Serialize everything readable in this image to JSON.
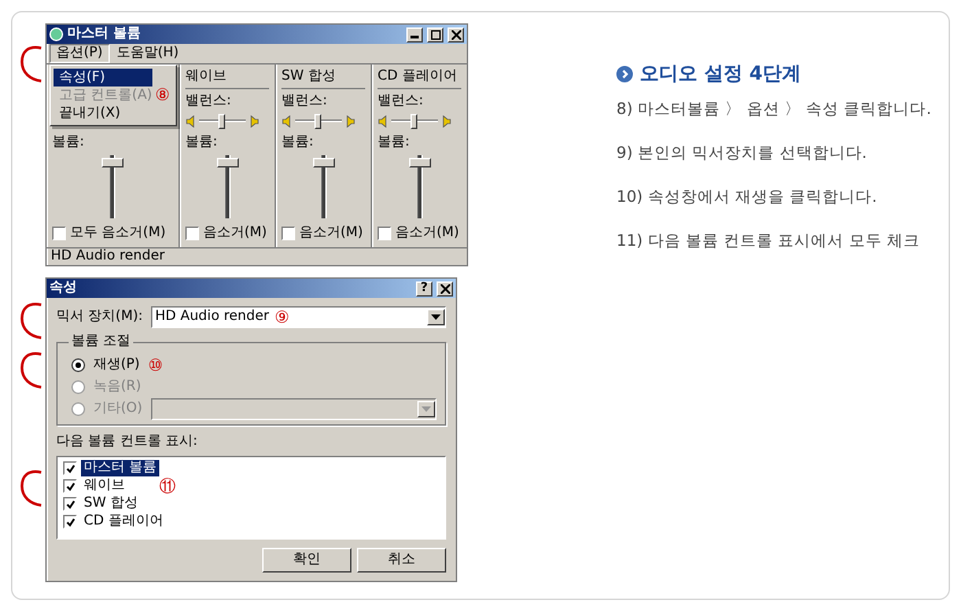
{
  "mixer_window": {
    "title": "마스터 볼륨",
    "menu": [
      {
        "label": "옵션(P)",
        "selected": true
      },
      {
        "label": "도움말(H)",
        "selected": false
      }
    ],
    "dropdown": {
      "annotation": "⑧",
      "items": [
        {
          "label": "속성(F)",
          "selected": true,
          "disabled": false
        },
        {
          "label": "고급 컨트롤(A)",
          "selected": false,
          "disabled": true
        },
        {
          "label": "끝내기(X)",
          "selected": false,
          "disabled": false
        }
      ]
    },
    "channels": [
      {
        "kind": "master",
        "volume": {
          "label": "볼륨:",
          "level": 0.95
        },
        "mute": {
          "label": "모두 음소거(M)",
          "checked": false
        }
      },
      {
        "kind": "line",
        "name": "웨이브",
        "balance": {
          "label": "밸런스:",
          "level": 0.5
        },
        "volume": {
          "label": "볼륨:",
          "level": 0.95
        },
        "mute": {
          "label": "음소거(M)",
          "checked": false
        }
      },
      {
        "kind": "line",
        "name": "SW 합성",
        "balance": {
          "label": "밸런스:",
          "level": 0.5
        },
        "volume": {
          "label": "볼륨:",
          "level": 0.95
        },
        "mute": {
          "label": "음소거(M)",
          "checked": false
        }
      },
      {
        "kind": "line",
        "name": "CD 플레이어",
        "balance": {
          "label": "밸런스:",
          "level": 0.5
        },
        "volume": {
          "label": "볼륨:",
          "level": 0.95
        },
        "mute": {
          "label": "음소거(M)",
          "checked": false
        }
      }
    ],
    "status_bar": "HD Audio render"
  },
  "properties_dialog": {
    "title": "속성",
    "help_button": "?",
    "mixer_device": {
      "label": "믹서 장치(M):",
      "value": "HD Audio render",
      "annotation": "⑨"
    },
    "volume_control": {
      "legend": "볼륨 조절",
      "annotation": "⑩",
      "options": [
        {
          "label": "재생(P)",
          "selected": true,
          "disabled": false
        },
        {
          "label": "녹음(R)",
          "selected": false,
          "disabled": true
        },
        {
          "label": "기타(O)",
          "selected": false,
          "disabled": true
        }
      ]
    },
    "controls_list": {
      "label": "다음 볼륨 컨트롤 표시:",
      "annotation": "⑪",
      "items": [
        {
          "label": "마스터 볼륨",
          "checked": true,
          "selected": true
        },
        {
          "label": "웨이브",
          "checked": true,
          "selected": false
        },
        {
          "label": "SW 합성",
          "checked": true,
          "selected": false
        },
        {
          "label": "CD 플레이어",
          "checked": true,
          "selected": false
        }
      ]
    },
    "buttons": [
      "확인",
      "취소"
    ]
  },
  "guide": {
    "heading": "오디오 설정 4단계",
    "steps": [
      "8) 마스터볼륨 〉 옵션 〉 속성 클릭합니다.",
      "9) 본인의 믹서장치를 선택합니다.",
      "10) 속성창에서 재생을 클릭합니다.",
      "11) 다음 볼륨 컨트롤 표시에서 모두 체크"
    ]
  }
}
